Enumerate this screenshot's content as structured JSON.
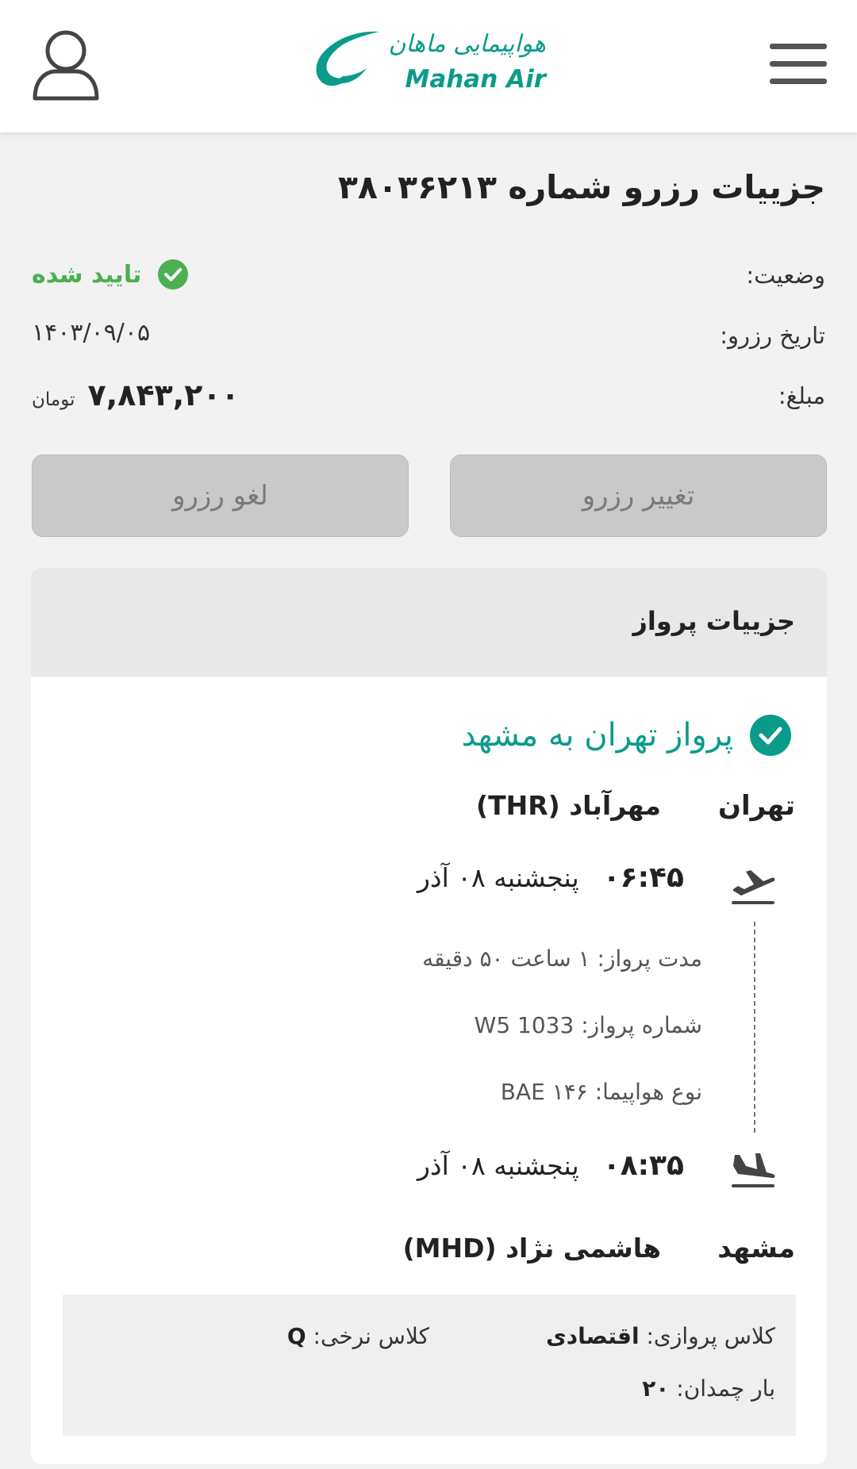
{
  "header": {
    "logo_fa": "هواپیمایی ماهان",
    "logo_en": "Mahan Air",
    "menu_icon": "hamburger-menu-icon",
    "user_icon": "user-profile-icon"
  },
  "booking": {
    "title": "جزییات رزرو شماره ۳۸۰۳۶۲۱۳",
    "status_label": "وضعیت:",
    "status_value": "تایید شده",
    "date_label": "تاریخ رزرو:",
    "date_value": "۱۴۰۳/۰۹/۰۵",
    "amount_label": "مبلغ:",
    "amount_value": "۷,۸۴۳,۲۰۰",
    "amount_currency": "تومان",
    "change_button": "تغییر رزرو",
    "cancel_button": "لغو رزرو"
  },
  "flight_details": {
    "section_title": "جزییات پرواز",
    "route_title": "پرواز تهران به مشهد",
    "origin_city": "تهران",
    "origin_airport": "مهرآباد (THR)",
    "departure_time": "۰۶:۴۵",
    "departure_date": "پنجشنبه ۰۸ آذر",
    "duration": "مدت پرواز: ۱ ساعت ۵۰ دقیقه",
    "flight_number": "شماره پرواز: W5 1033",
    "aircraft": "نوع هواپیما: BAE ۱۴۶",
    "arrival_time": "۰۸:۳۵",
    "arrival_date": "پنجشنبه ۰۸ آذر",
    "destination_city": "مشهد",
    "destination_airport": "هاشمی نژاد (MHD)",
    "cabin_class_label": "کلاس پروازی:",
    "cabin_class_value": "اقتصادی",
    "fare_class_label": "کلاس نرخی:",
    "fare_class_value": "Q",
    "baggage_label": "بار چمدان:",
    "baggage_value": "۲۰"
  },
  "colors": {
    "brand_teal": "#0a9b8a",
    "status_green": "#4caf50",
    "disabled_button": "#c9c9c9"
  }
}
